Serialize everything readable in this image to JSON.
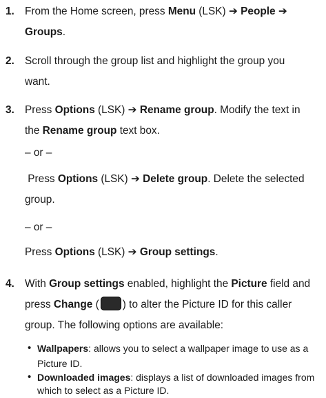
{
  "steps": [
    {
      "number": "1.",
      "line1": {
        "a": "From the Home screen, press ",
        "menu": "Menu",
        "lsk": " (LSK) ",
        "arrow1": "➔",
        "sp": " ",
        "people": "People",
        "arrow2": " ➔"
      },
      "line2": {
        "groups": "Groups",
        "end": "."
      }
    },
    {
      "number": "2.",
      "line1": "Scroll through the group list and highlight the group you",
      "line2": "want."
    },
    {
      "number": "3.",
      "line1": {
        "press": "Press ",
        "options": "Options",
        "lsk": " (LSK) ",
        "arrow": "➔",
        "sp": " ",
        "rename": "Rename group",
        "end": ". Modify the text in"
      },
      "line2": {
        "the": "the ",
        "rename": "Rename group",
        "end": " text box."
      },
      "or1": "– or –",
      "line3": {
        "press": " Press ",
        "options": "Options",
        "lsk": " (LSK) ",
        "arrow": "➔",
        "sp": " ",
        "delete": "Delete group",
        "end": ". Delete the selected"
      },
      "line4": "group.",
      "or2": "– or –",
      "line5": {
        "press": "Press ",
        "options": "Options",
        "lsk": " (LSK) ",
        "arrow": "➔",
        "sp": " ",
        "settings": "Group settings",
        "end": "."
      }
    },
    {
      "number": "4.",
      "line1": {
        "with": "With ",
        "settings": "Group settings",
        "mid": " enabled, highlight the ",
        "picture": "Picture",
        "end": " field and"
      },
      "line2": {
        "press": "press ",
        "change": "Change",
        "open": " (",
        "close": ") to alter the Picture ID for this caller"
      },
      "line3": "group. The following options are available:",
      "key_icon": "center-key-icon"
    }
  ],
  "bullets": [
    {
      "term": "Wallpapers",
      "line1": ": allows you to select a wallpaper image to use as a",
      "line2": "Picture ID."
    },
    {
      "term": "Downloaded images",
      "line1": ": displays a list of downloaded images from",
      "line2": "which to select as a Picture ID."
    }
  ],
  "bullet_symbol": "•"
}
